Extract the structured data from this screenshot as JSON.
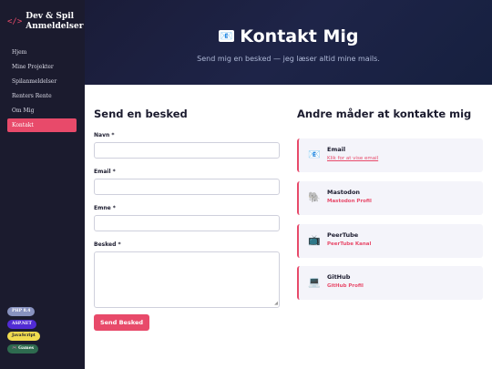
{
  "brand": {
    "icon": "</>",
    "title": "Dev & Spil Anmeldelser"
  },
  "nav": [
    {
      "label": "Hjem"
    },
    {
      "label": "Mine Projekter"
    },
    {
      "label": "Spilanmeldelser"
    },
    {
      "label": "Renters Rente"
    },
    {
      "label": "Om Mig"
    },
    {
      "label": "Kontakt",
      "active": true
    }
  ],
  "badges": [
    {
      "label": "PHP 8.4",
      "color": "#8892bf",
      "text_color": "#ffffff"
    },
    {
      "label": "ASP.NET",
      "color": "#512bd4",
      "text_color": "#ffffff"
    },
    {
      "label": "JavaScript",
      "color": "#f0db4f",
      "text_color": "#1b1b2e"
    },
    {
      "label": "🎮 Games",
      "color": "#2e6b4f",
      "text_color": "#ffffff"
    }
  ],
  "hero": {
    "icon": "📧",
    "title": "Kontakt Mig",
    "subtitle": "Send mig en besked — jeg læser altid mine mails."
  },
  "form": {
    "title": "Send en besked",
    "fields": {
      "name": {
        "label": "Navn *",
        "value": ""
      },
      "email": {
        "label": "Email *",
        "value": ""
      },
      "subject": {
        "label": "Emne *",
        "value": ""
      },
      "message": {
        "label": "Besked *",
        "value": ""
      }
    },
    "submit_label": "Send Besked"
  },
  "alternatives": {
    "title": "Andre måder at kontakte mig",
    "items": [
      {
        "icon": "📧",
        "title": "Email",
        "link": "Klik for at vise email"
      },
      {
        "icon": "🐘",
        "title": "Mastodon",
        "link": "Mastodon Profil"
      },
      {
        "icon": "📺",
        "title": "PeerTube",
        "link": "PeerTube Kanal"
      },
      {
        "icon": "💻",
        "title": "GitHub",
        "link": "GitHub Profil"
      }
    ]
  },
  "colors": {
    "accent": "#e84a6a",
    "sidebar": "#1b1b2e",
    "hero": "#1e2448"
  }
}
